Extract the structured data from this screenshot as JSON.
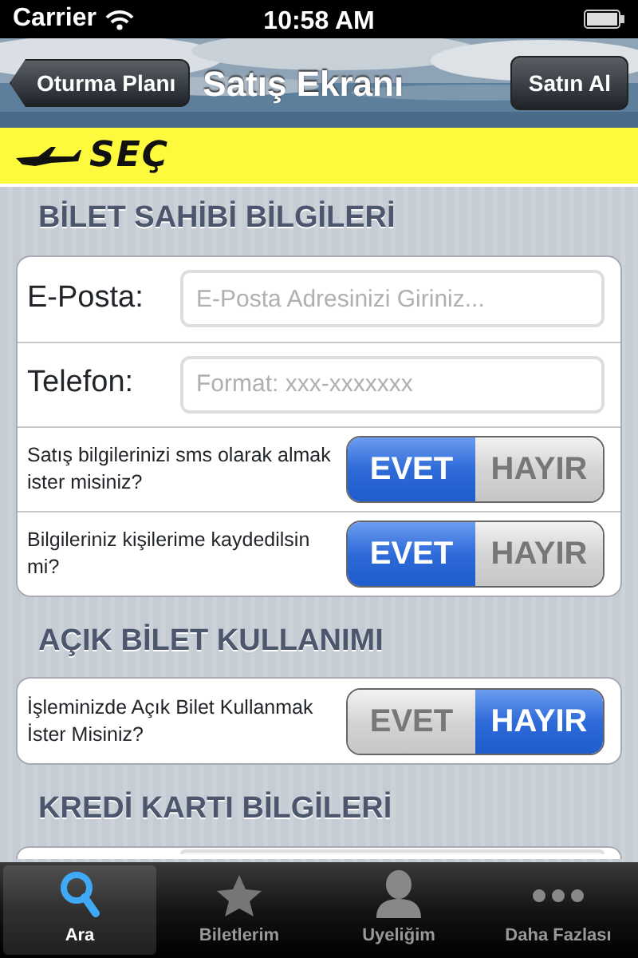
{
  "status_bar": {
    "carrier": "Carrier",
    "time": "10:58 AM"
  },
  "nav_bar": {
    "back_button": "Oturma Planı",
    "title": "Satış Ekranı",
    "action_button": "Satın Al"
  },
  "banner": {
    "logo_text": "SEÇ"
  },
  "sections": [
    {
      "title": "BİLET SAHİBİ BİLGİLERİ",
      "rows": [
        {
          "kind": "field",
          "label": "E-Posta:",
          "placeholder": "E-Posta Adresinizi Giriniz..."
        },
        {
          "kind": "field",
          "label": "Telefon:",
          "placeholder": "Format: xxx-xxxxxxx"
        },
        {
          "kind": "toggle",
          "label": "Satış bilgilerinizi sms olarak almak ister misiniz?",
          "options": [
            {
              "label": "EVET",
              "selected": true
            },
            {
              "label": "HAYIR",
              "selected": false
            }
          ]
        },
        {
          "kind": "toggle",
          "label": "Bilgileriniz kişilerime kaydedilsin mi?",
          "options": [
            {
              "label": "EVET",
              "selected": true
            },
            {
              "label": "HAYIR",
              "selected": false
            }
          ]
        }
      ]
    },
    {
      "title": "AÇIK BİLET KULLANIMI",
      "rows": [
        {
          "kind": "toggle",
          "label": "İşleminizde Açık Bilet Kullanmak İster Misiniz?",
          "options": [
            {
              "label": "EVET",
              "selected": false
            },
            {
              "label": "HAYIR",
              "selected": true
            }
          ]
        }
      ]
    },
    {
      "title": "KREDİ KARTI BİLGİLERİ",
      "rows": [
        {
          "kind": "field"
        }
      ]
    }
  ],
  "tab_bar": [
    {
      "label": "Ara",
      "selected": true
    },
    {
      "label": "Biletlerim",
      "selected": false
    },
    {
      "label": "Uyeliğim",
      "selected": false
    },
    {
      "label": "Daha Fazlası",
      "selected": false
    }
  ]
}
